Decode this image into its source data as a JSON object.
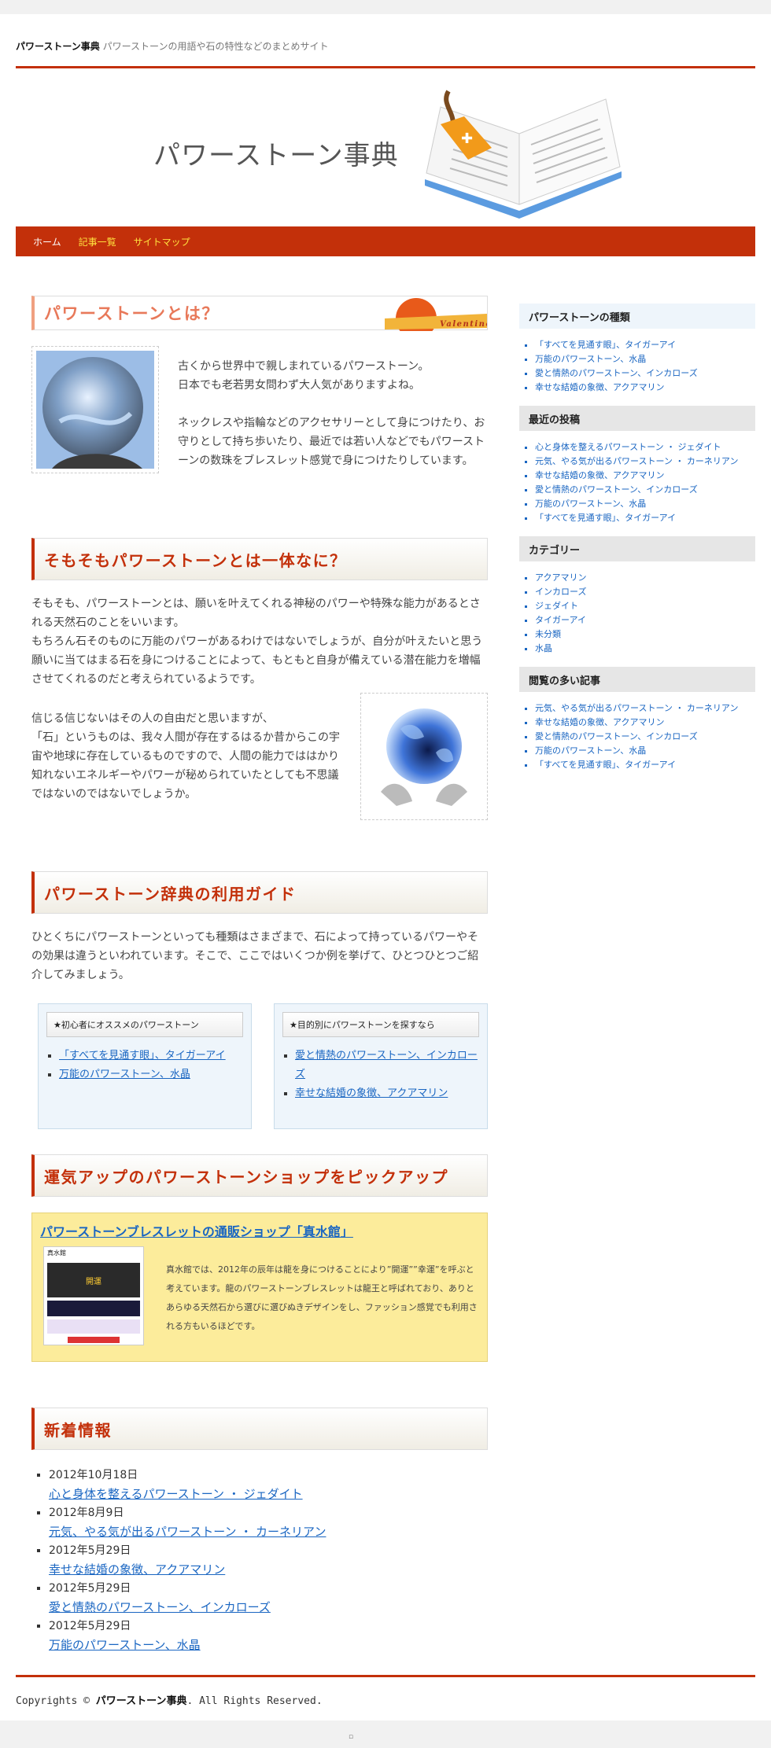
{
  "header": {
    "site_name": "パワーストーン事典",
    "tagline": "パワーストーンの用語や石の特性などのまとめサイト",
    "banner_title": "パワーストーン事典"
  },
  "nav": {
    "items": [
      "ホーム",
      "記事一覧",
      "サイトマップ"
    ],
    "colors": [
      "#ffffff",
      "#ffe23f",
      "#ffe23f"
    ]
  },
  "intro": {
    "heading": "パワーストーンとは？",
    "ribbon_text": "Valentine",
    "p1": "古くから世界中で親しまれているパワーストーン。\n日本でも老若男女問わず大人気がありますよね。",
    "p2": "ネックレスや指輪などのアクセサリーとして身につけたり、お守りとして持ち歩いたり、最近では若い人などでもパワーストーンの数珠をブレスレット感覚で身につけたりしています。"
  },
  "what_is": {
    "heading": "そもそもパワーストーンとは一体なに？",
    "p1": "そもそも、パワーストーンとは、願いを叶えてくれる神秘のパワーや特殊な能力があるとされる天然石のことをいいます。\nもちろん石そのものに万能のパワーがあるわけではないでしょうが、自分が叶えたいと思う願いに当てはまる石を身につけることによって、もともと自身が備えている潜在能力を増幅させてくれるのだと考えられているようです。",
    "p2": "信じる信じないはその人の自由だと思いますが、\n「石」というものは、我々人間が存在するはるか昔からこの宇宙や地球に存在しているものですので、人間の能力でははかり知れないエネルギーやパワーが秘められていたとしても不思議ではないのではないでしょうか。"
  },
  "guide": {
    "heading": "パワーストーン辞典の利用ガイド",
    "p": "ひとくちにパワーストーンといっても種類はさまざまで、石によって持っているパワーやその効果は違うといわれています。そこで、ここではいくつか例を挙げて、ひとつひとつご紹介してみましょう。",
    "boxes": [
      {
        "title": "★初心者にオススメのパワーストーン",
        "links": [
          "「すべてを見通す眼」、タイガーアイ",
          "万能のパワーストーン、水晶"
        ]
      },
      {
        "title": "★目的別にパワーストーンを探すなら",
        "links": [
          "愛と情熱のパワーストーン、インカローズ",
          "幸せな結婚の象徴、アクアマリン"
        ]
      }
    ]
  },
  "shop": {
    "heading": "運気アップのパワーストーンショップをピックアップ",
    "title": "パワーストーンブレスレットの通販ショップ「真水館」",
    "shot_logo": "真水館",
    "shot_banner": "開運",
    "desc": "真水館では、2012年の辰年は龍を身につけることにより”開運””幸運”を呼ぶと考えています。龍のパワーストーンブレスレットは龍王と呼ばれており、ありとあらゆる天然石から選びに選びぬきデザインをし、ファッション感覚でも利用される方もいるほどです。"
  },
  "news": {
    "heading": "新着情報",
    "items": [
      {
        "date": "2012年10月18日",
        "title": "心と身体を整えるパワーストーン ・ ジェダイト"
      },
      {
        "date": "2012年8月9日",
        "title": "元気、やる気が出るパワーストーン ・ カーネリアン"
      },
      {
        "date": "2012年5月29日",
        "title": "幸せな結婚の象徴、アクアマリン"
      },
      {
        "date": "2012年5月29日",
        "title": "愛と情熱のパワーストーン、インカローズ"
      },
      {
        "date": "2012年5月29日",
        "title": "万能のパワーストーン、水晶"
      }
    ]
  },
  "sidebar": {
    "types": {
      "heading": "パワーストーンの種類",
      "items": [
        "「すべてを見通す眼」、タイガーアイ",
        "万能のパワーストーン、水晶",
        "愛と情熱のパワーストーン、インカローズ",
        "幸せな結婚の象徴、アクアマリン"
      ]
    },
    "recent": {
      "heading": "最近の投稿",
      "items": [
        "心と身体を整えるパワーストーン ・ ジェダイト",
        "元気、やる気が出るパワーストーン ・ カーネリアン",
        "幸せな結婚の象徴、アクアマリン",
        "愛と情熱のパワーストーン、インカローズ",
        "万能のパワーストーン、水晶",
        "「すべてを見通す眼」、タイガーアイ"
      ]
    },
    "categories": {
      "heading": "カテゴリー",
      "items": [
        "アクアマリン",
        "インカローズ",
        "ジェダイト",
        "タイガーアイ",
        "未分類",
        "水晶"
      ]
    },
    "popular": {
      "heading": "閲覧の多い記事",
      "items": [
        "元気、やる気が出るパワーストーン ・ カーネリアン",
        "幸せな結婚の象徴、アクアマリン",
        "愛と情熱のパワーストーン、インカローズ",
        "万能のパワーストーン、水晶",
        "「すべてを見通す眼」、タイガーアイ"
      ]
    }
  },
  "footer": {
    "prefix": "Copyrights © ",
    "site": "パワーストーン事典",
    "suffix": ". All Rights Reserved."
  },
  "bottom_mark": "▫",
  "colors": {
    "accent": "#c3300a",
    "link": "#1a66c2",
    "sidebar_blue": "#eef5fb",
    "shop_bg": "#fcec9b"
  }
}
